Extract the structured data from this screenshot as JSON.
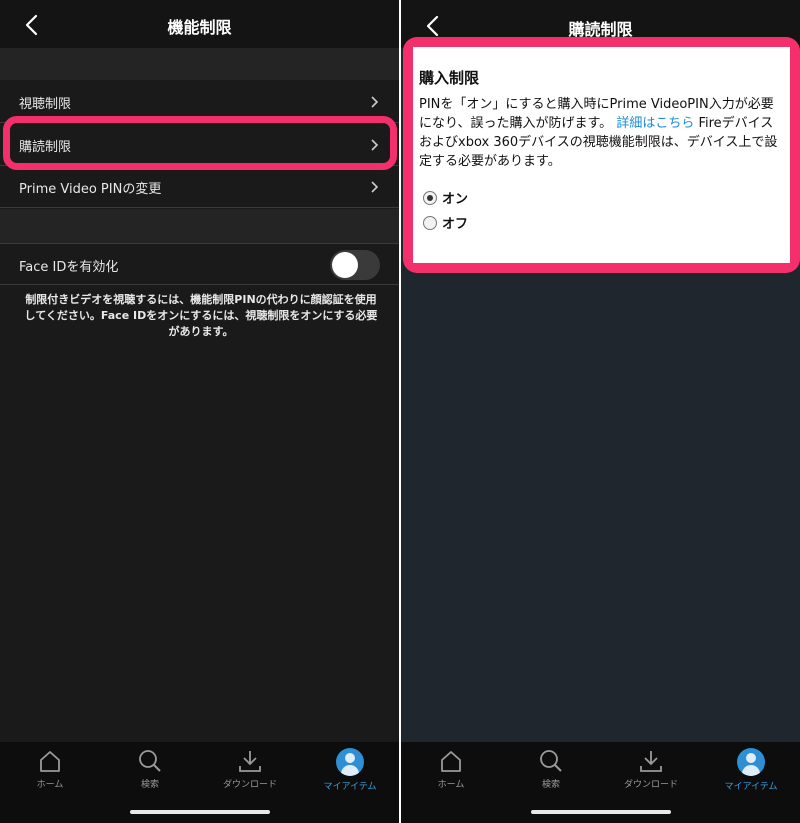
{
  "left": {
    "title": "機能制限",
    "menu": [
      {
        "label": "視聴制限"
      },
      {
        "label": "購読制限"
      },
      {
        "label": "Prime Video PINの変更"
      }
    ],
    "face_id": {
      "label": "Face IDを有効化",
      "enabled": false
    },
    "note": "制限付きビデオを視聴するには、機能制限PINの代わりに顔認証を使用してください。Face IDをオンにするには、視聴制限をオンにする必要があります。"
  },
  "right": {
    "title": "購読制限",
    "dialog": {
      "heading": "購入制限",
      "body_1": "PINを「オン」にすると購入時にPrime VideoPIN入力が必要になり、誤った購入が防げます。",
      "link": "詳細はこちら",
      "body_2": "Fireデバイスおよびxbox 360デバイスの視聴機能制限は、デバイス上で設定する必要があります。",
      "options": [
        {
          "label": "オン",
          "selected": true
        },
        {
          "label": "オフ",
          "selected": false
        }
      ]
    }
  },
  "tabbar": {
    "items": [
      {
        "label": "ホーム",
        "icon": "home-icon"
      },
      {
        "label": "検索",
        "icon": "search-icon"
      },
      {
        "label": "ダウンロード",
        "icon": "download-icon"
      },
      {
        "label": "マイアイテム",
        "icon": "avatar-icon",
        "active": true
      }
    ]
  },
  "colors": {
    "highlight": "#f4306c",
    "link": "#1a8cd8",
    "active_tab": "#3aa0e0"
  }
}
